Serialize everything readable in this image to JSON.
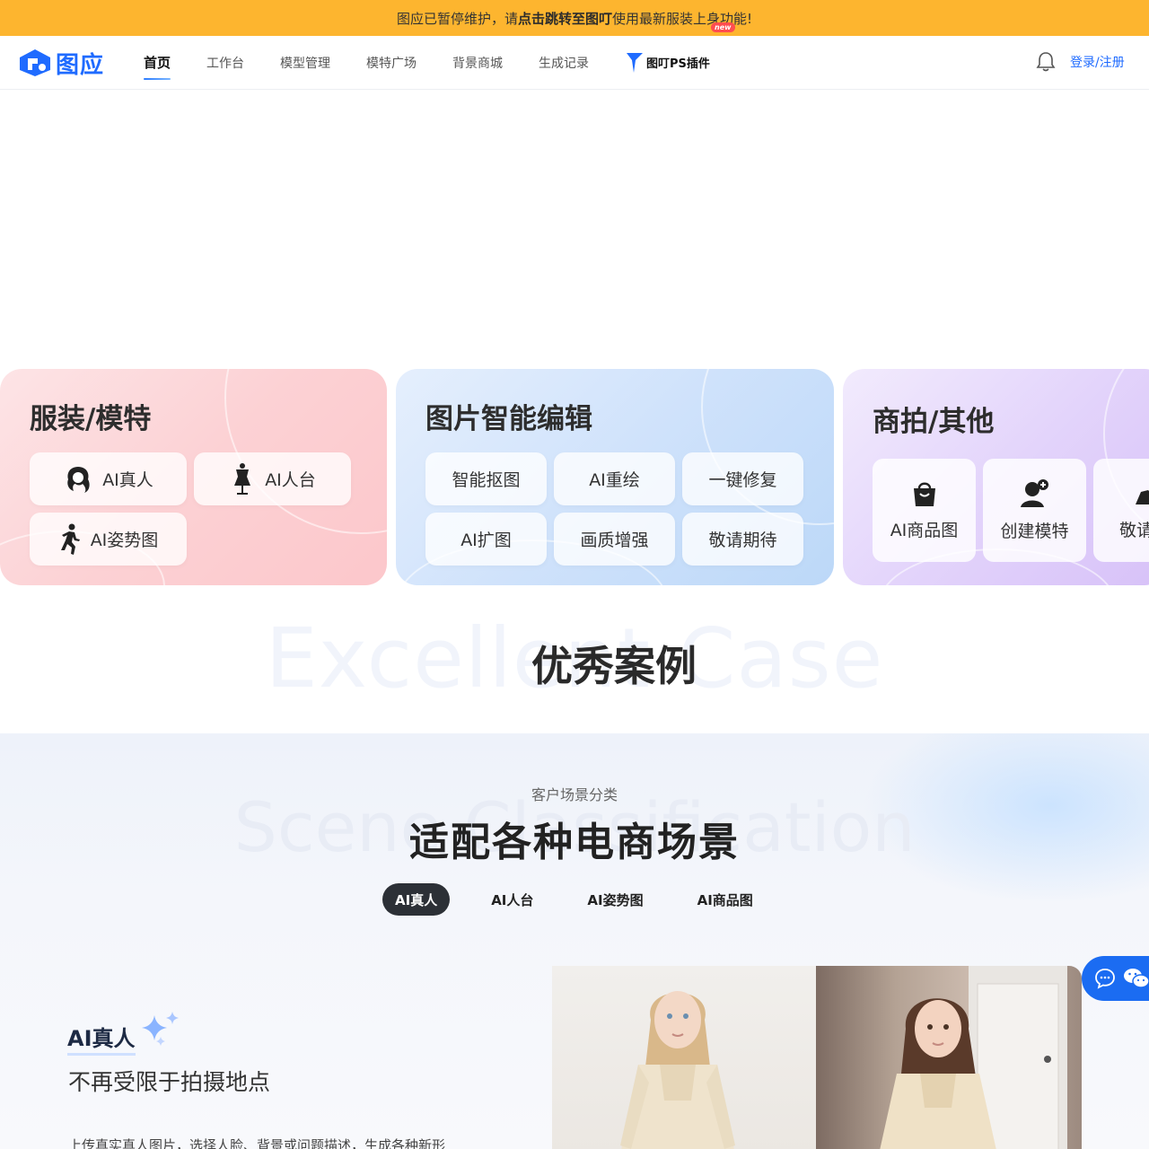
{
  "banner": {
    "prefix": "图应已暂停维护，请",
    "link": "点击跳转至图叮",
    "suffix": "使用最新服装上身功能!"
  },
  "header": {
    "logo_text": "图应",
    "nav": [
      "首页",
      "工作台",
      "模型管理",
      "模特广场",
      "背景商城",
      "生成记录"
    ],
    "plugin_label": "图叮PS插件",
    "plugin_badge": "new",
    "login": "登录/注册"
  },
  "cards": {
    "apparel": {
      "title": "服装/模特",
      "items": [
        "AI真人",
        "AI人台",
        "AI姿势图"
      ]
    },
    "edit": {
      "title": "图片智能编辑",
      "items": [
        "智能抠图",
        "AI重绘",
        "一键修复",
        "AI扩图",
        "画质增强",
        "敬请期待"
      ]
    },
    "other": {
      "title": "商拍/其他",
      "items": [
        "AI商品图",
        "创建模特",
        "敬请期"
      ]
    }
  },
  "case": {
    "bg_text": "Excellent Case",
    "title": "优秀案例"
  },
  "scene": {
    "subtitle": "客户场景分类",
    "bg_text": "Scene Classification",
    "title": "适配各种电商场景",
    "tabs": [
      "AI真人",
      "AI人台",
      "AI姿势图",
      "AI商品图"
    ],
    "active_tab": "AI真人",
    "feature": {
      "name": "AI真人",
      "tagline": "不再受限于拍摄地点",
      "desc": "上传真实真人图片，选择人脸、背景或问题描述，生成各种新形"
    }
  },
  "colors": {
    "accent": "#1f6bff",
    "banner": "#fdb52f",
    "tab_active": "#2c3036"
  }
}
